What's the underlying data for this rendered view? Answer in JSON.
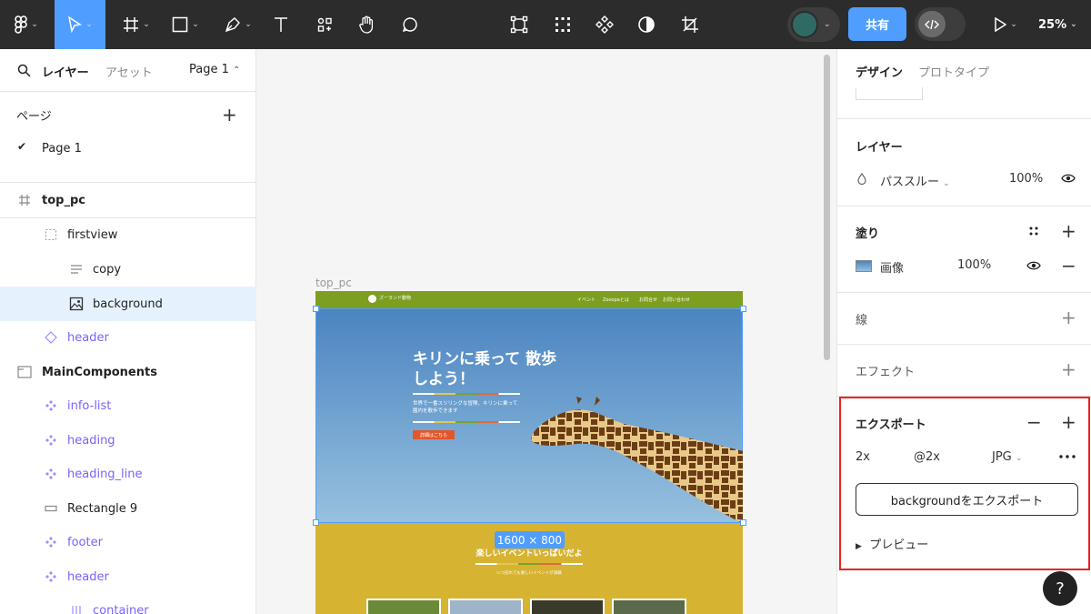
{
  "toolbar": {
    "tools": [
      "figma-menu",
      "move",
      "frame",
      "shape",
      "pen",
      "text",
      "resources",
      "hand",
      "comment"
    ],
    "center_tools": [
      "component",
      "grid",
      "variants",
      "contrast",
      "crop"
    ],
    "share_label": "共有",
    "zoom": "25%"
  },
  "left_panel": {
    "tab_layers": "レイヤー",
    "tab_assets": "アセット",
    "page_selector": "Page 1",
    "pages_heading": "ページ",
    "pages": [
      {
        "name": "Page 1",
        "checked": true
      }
    ],
    "layers": [
      {
        "name": "top_pc",
        "type": "frame"
      },
      {
        "name": "firstview",
        "type": "group"
      },
      {
        "name": "copy",
        "type": "text"
      },
      {
        "name": "background",
        "type": "image",
        "selected": true
      },
      {
        "name": "header",
        "type": "instance"
      },
      {
        "name": "MainComponents",
        "type": "section"
      },
      {
        "name": "info-list",
        "type": "component"
      },
      {
        "name": "heading",
        "type": "component"
      },
      {
        "name": "heading_line",
        "type": "component"
      },
      {
        "name": "Rectangle 9",
        "type": "rectangle"
      },
      {
        "name": "footer",
        "type": "component"
      },
      {
        "name": "header",
        "type": "component"
      },
      {
        "name": "container",
        "type": "layout"
      }
    ]
  },
  "canvas": {
    "frame_label": "top_pc",
    "site_title": "ズーランド動物",
    "nav_items": [
      "イベント",
      "Zooopaとは",
      "お問合せ",
      "お問い合わせ"
    ],
    "hero_title": "キリンに乗って 散歩しよう！",
    "hero_copy": "世界で一番スリリングな冒険、キリンに乗って園内を散歩できます",
    "hero_button": "詳細はこちら",
    "dimension_badge": "1600 × 800",
    "section_title": "楽しいイベントいっぱいだよ",
    "section_sub": "いつ訪れても楽しいイベントが満載"
  },
  "right_panel": {
    "tab_design": "デザイン",
    "tab_prototype": "プロトタイプ",
    "layer_heading": "レイヤー",
    "blend_mode": "パススルー",
    "layer_opacity": "100%",
    "fill_heading": "塗り",
    "fill_type": "画像",
    "fill_opacity": "100%",
    "stroke_heading": "線",
    "effect_heading": "エフェクト",
    "export_heading": "エクスポート",
    "export_scale": "2x",
    "export_suffix": "@2x",
    "export_format": "JPG",
    "export_button": "backgroundをエクスポート",
    "preview_label": "プレビュー"
  },
  "help_label": "?"
}
